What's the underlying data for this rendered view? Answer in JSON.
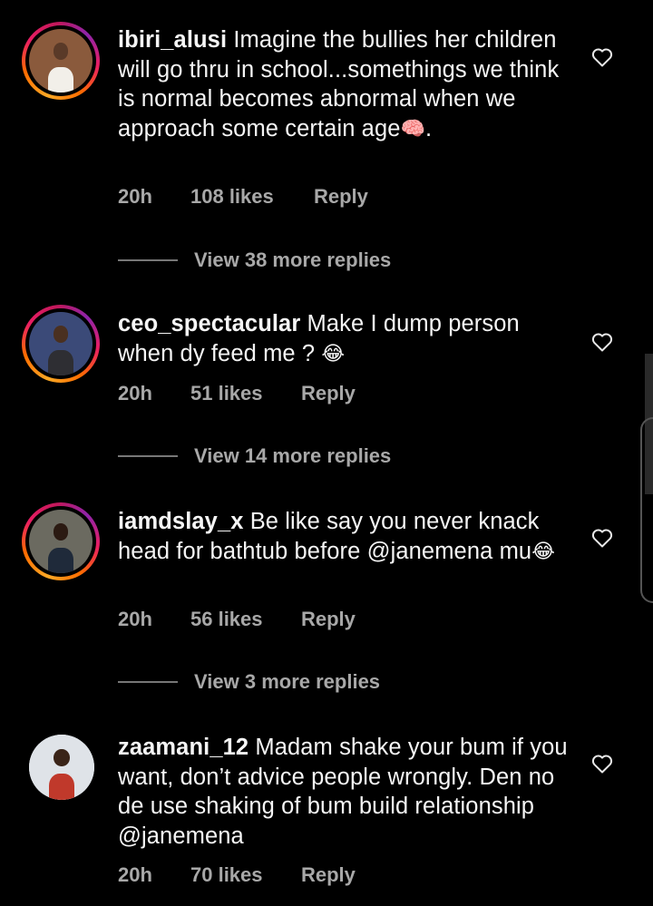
{
  "comments": [
    {
      "username": "ibiri_alusi",
      "text": " Imagine the bullies her children will go thru in school...somethings we think is normal becomes abnormal when we approach some certain age",
      "emoji": "🧠",
      "text_end": ".",
      "time": "20h",
      "likes": "108 likes",
      "reply": "Reply",
      "view_replies": "View 38 more replies",
      "icon": "heart-outline-icon"
    },
    {
      "username": "ceo_spectacular",
      "text": " Make I dump person when dy feed me ? ",
      "emoji": "😂",
      "text_end": "",
      "time": "20h",
      "likes": "51 likes",
      "reply": "Reply",
      "view_replies": "View 14 more replies",
      "icon": "heart-outline-icon"
    },
    {
      "username": "iamdslay_x",
      "text": " Be like say you never knack head for bathtub before @janemena mu",
      "emoji": "😂",
      "text_end": "",
      "time": "20h",
      "likes": "56 likes",
      "reply": "Reply",
      "view_replies": "View 3 more replies",
      "icon": "heart-outline-icon"
    },
    {
      "username": "zaamani_12",
      "text": " Madam shake your bum if you want, don’t advice people wrongly. Den no de use shaking of bum build relationship @janemena",
      "emoji": "",
      "text_end": "",
      "time": "20h",
      "likes": "70 likes",
      "reply": "Reply",
      "icon": "heart-outline-icon"
    }
  ],
  "colors": {
    "background": "#000000",
    "text": "#f5f5f5",
    "meta": "#a8a8a8"
  }
}
